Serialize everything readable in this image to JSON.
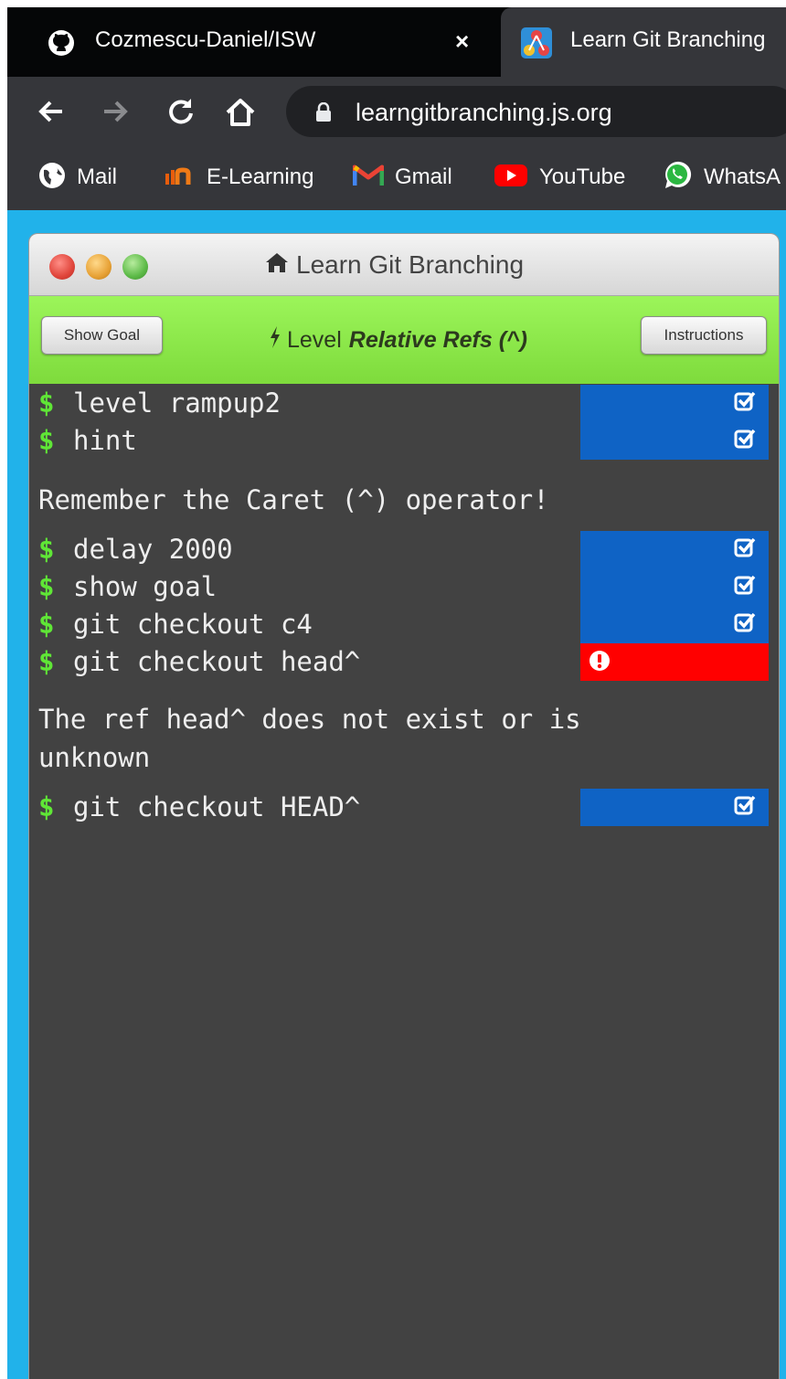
{
  "browser": {
    "tabs": [
      {
        "title": "Cozmescu-Daniel/ISW",
        "icon": "github-icon",
        "active": false,
        "close": "×"
      },
      {
        "title": "Learn Git Branching",
        "icon": "learngit-favicon-icon",
        "active": true
      }
    ],
    "url": "learngitbranching.js.org",
    "bookmarks": [
      {
        "label": "Mail",
        "icon": "globe-icon"
      },
      {
        "label": "E-Learning",
        "icon": "elearning-icon"
      },
      {
        "label": "Gmail",
        "icon": "gmail-icon"
      },
      {
        "label": "YouTube",
        "icon": "youtube-icon"
      },
      {
        "label": "WhatsA",
        "icon": "whatsapp-icon"
      }
    ]
  },
  "app": {
    "window_title": "Learn Git Branching",
    "show_goal": "Show Goal",
    "instructions": "Instructions",
    "level_prefix": "Level",
    "level_name": "Relative Refs (^)"
  },
  "terminal": {
    "prompt": "$",
    "commands": [
      {
        "text": "level rampup2",
        "status": "success"
      },
      {
        "text": "hint",
        "status": "success"
      },
      {
        "text": "delay 2000",
        "status": "success"
      },
      {
        "text": "show goal",
        "status": "success"
      },
      {
        "text": "git checkout c4",
        "status": "success"
      },
      {
        "text": "git checkout head^",
        "status": "error"
      },
      {
        "text": "git checkout HEAD^",
        "status": "success"
      }
    ],
    "messages": [
      "Remember the Caret (^) operator!",
      "The ref head^ does not exist or is unknown"
    ]
  },
  "colors": {
    "success_status": "#0f63c5",
    "error_status": "#ff0000",
    "prompt": "#5fe636",
    "level_bar": "#8ee84a",
    "page_background": "#21b2ea"
  }
}
